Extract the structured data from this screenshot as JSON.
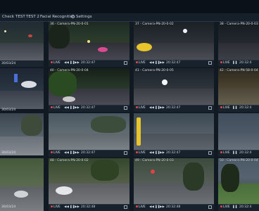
{
  "menu": {
    "items": [
      "Check",
      "TEST",
      "TEST 2",
      "Facial Recognition",
      "Settings"
    ]
  },
  "cameras": [
    {
      "label": "",
      "live": "",
      "time": "",
      "date": "30/03/24"
    },
    {
      "label": "36 - Camera-PN-20-0-01",
      "live": "LIVE",
      "time": "20:32:47",
      "date": ""
    },
    {
      "label": "37 - Camera-PN-20-0-02",
      "live": "LIVE",
      "time": "20:32:47",
      "date": ""
    },
    {
      "label": "38 - Camera-PN-20-0-03",
      "live": "LIVE",
      "time": "20:32:4",
      "date": ""
    },
    {
      "label": "",
      "live": "",
      "time": "",
      "date": "30/03/24"
    },
    {
      "label": "40 - Camera-PN-20-0-04",
      "live": "LIVE",
      "time": "20:32:47",
      "date": ""
    },
    {
      "label": "41 - Camera-PN-20-0-05",
      "live": "LIVE",
      "time": "20:32:47",
      "date": ""
    },
    {
      "label": "42 - Camera-PN-58-0-04",
      "live": "LIVE",
      "time": "20:32:4",
      "date": ""
    },
    {
      "label": "",
      "live": "",
      "time": "",
      "date": "30/03/24"
    },
    {
      "label": "",
      "live": "LIVE",
      "time": "20:32:47",
      "date": ""
    },
    {
      "label": "",
      "live": "LIVE",
      "time": "20:32:47",
      "date": ""
    },
    {
      "label": "",
      "live": "LIVE",
      "time": "20:32:4",
      "date": ""
    },
    {
      "label": "",
      "live": "",
      "time": "",
      "date": "30/03/24"
    },
    {
      "label": "48 - Camera-PN-20-0-02",
      "live": "LIVE",
      "time": "20:32:48",
      "date": ""
    },
    {
      "label": "49 - Camera-PN-20-0-03",
      "live": "LIVE",
      "time": "20:32:48",
      "date": ""
    },
    {
      "label": "50 - Camera-PN-20-0-04",
      "live": "LIVE",
      "time": "20:32:4",
      "date": ""
    }
  ],
  "colors": {
    "accent_live": "#e14b4b",
    "bar_bg": "#18222d"
  }
}
